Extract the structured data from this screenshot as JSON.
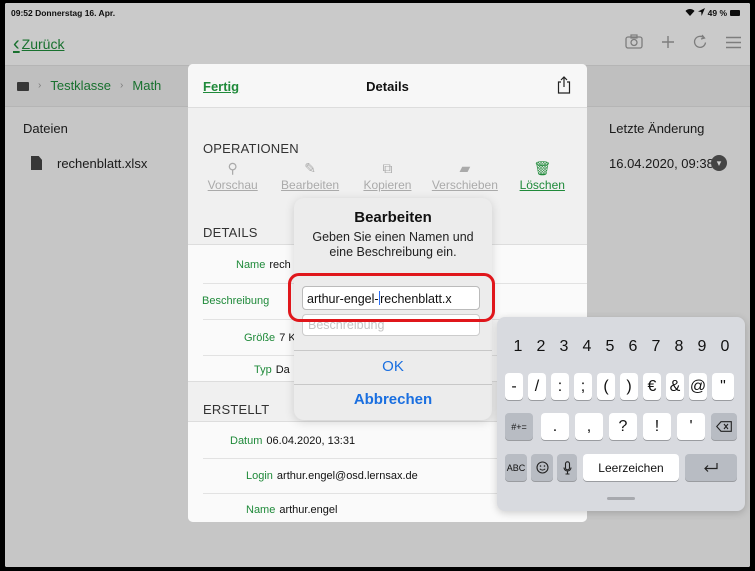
{
  "status_bar": {
    "time_date": "09:52 Donnerstag 16. Apr.",
    "battery_text": "49 %"
  },
  "nav": {
    "back_label": "Zurück"
  },
  "breadcrumb": {
    "items": [
      "Testklasse",
      "Math"
    ]
  },
  "files_table": {
    "col_files": "Dateien",
    "col_changed": "Letzte Änderung",
    "row": {
      "name": "rechenblatt.xlsx",
      "date": "16.04.2020, 09:38"
    }
  },
  "details_sheet": {
    "done_label": "Fertig",
    "title": "Details",
    "operations_label": "OPERATIONEN",
    "operations": [
      {
        "label": "Vorschau",
        "icon": "magnifier-icon"
      },
      {
        "label": "Bearbeiten",
        "icon": "pencil-icon"
      },
      {
        "label": "Kopieren",
        "icon": "copy-icon"
      },
      {
        "label": "Verschieben",
        "icon": "folder-move-icon"
      },
      {
        "label": "Löschen",
        "icon": "trash-icon"
      }
    ],
    "details_label": "DETAILS",
    "details": {
      "name_key": "Name",
      "name_value": "rech",
      "description_key": "Beschreibung",
      "size_key": "Größe",
      "size_value": "7 K",
      "type_key": "Typ",
      "type_value": "Da"
    },
    "created_label": "ERSTELLT",
    "created": {
      "date_key": "Datum",
      "date_value": "06.04.2020, 13:31",
      "login_key": "Login",
      "login_value": "arthur.engel@osd.lernsax.de",
      "name_key": "Name",
      "name_value": "arthur.engel"
    }
  },
  "alert": {
    "title": "Bearbeiten",
    "message": "Geben Sie einen Namen und eine Beschreibung ein.",
    "name_value_before_cursor": "arthur-engel-",
    "name_value_after_cursor": "rechenblatt.x",
    "description_placeholder": "Beschreibung",
    "ok_label": "OK",
    "cancel_label": "Abbrechen"
  },
  "keyboard": {
    "numbers": [
      "1",
      "2",
      "3",
      "4",
      "5",
      "6",
      "7",
      "8",
      "9",
      "0"
    ],
    "symbols": [
      "-",
      "/",
      ":",
      ";",
      "(",
      ")",
      "€",
      "&",
      "@",
      "\""
    ],
    "row3_mode": "#+=",
    "row3": [
      ".",
      ",",
      "?",
      "!",
      "'"
    ],
    "abc_label": "ABC",
    "space_label": "Leerzeichen"
  },
  "colors": {
    "accent_green": "#1f8a3a",
    "ios_blue": "#1a6fe0",
    "highlight_red": "#e0161b"
  }
}
